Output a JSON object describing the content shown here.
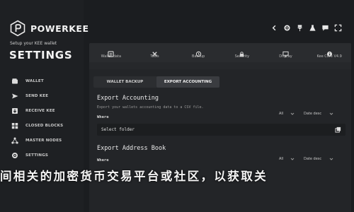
{
  "brand": {
    "name": "POWERKEE"
  },
  "sidebar": {
    "setup_subtitle": "Setup your KEE wallet",
    "title": "SETTINGS",
    "items": [
      {
        "label": "WALLET",
        "icon": "wallet-icon"
      },
      {
        "label": "SEND KEE",
        "icon": "send-icon"
      },
      {
        "label": "RECEIVE KEE",
        "icon": "receive-icon"
      },
      {
        "label": "CLOSED BLOCKS",
        "icon": "blocks-icon"
      },
      {
        "label": "MASTER NODES",
        "icon": "nodes-icon"
      },
      {
        "label": "SETTINGS",
        "icon": "settings-icon"
      }
    ]
  },
  "top_icons": [
    "chevron-left-icon",
    "settings-icon",
    "pin-icon",
    "flask-icon",
    "chat-icon",
    "expand-icon"
  ],
  "tabs": [
    {
      "label": "Wallet data",
      "icon": "wallet-data-icon"
    },
    {
      "label": "Tools",
      "icon": "tools-icon"
    },
    {
      "label": "Backup",
      "icon": "backup-icon"
    },
    {
      "label": "Security",
      "icon": "security-icon"
    },
    {
      "label": "Display",
      "icon": "display-icon"
    },
    {
      "label": "Kee Core V4.9",
      "icon": "info-icon"
    }
  ],
  "subtabs": {
    "wallet_backup": "WALLET BACKUP",
    "export_accounting": "EXPORT ACCOUNTING"
  },
  "export_accounting": {
    "title": "Export Accounting",
    "description": "Export your wallets accounting data to a CSV file.",
    "where_label": "Where",
    "filter_value": "All",
    "sort_value": "Date desc",
    "folder_placeholder": "Select folder"
  },
  "export_address_book": {
    "title": "Export Address Book",
    "where_label": "Where",
    "filter_value": "All",
    "sort_value": "Date desc"
  },
  "banner_text": "间相关的加密货币交易平台或社区，以获取关"
}
